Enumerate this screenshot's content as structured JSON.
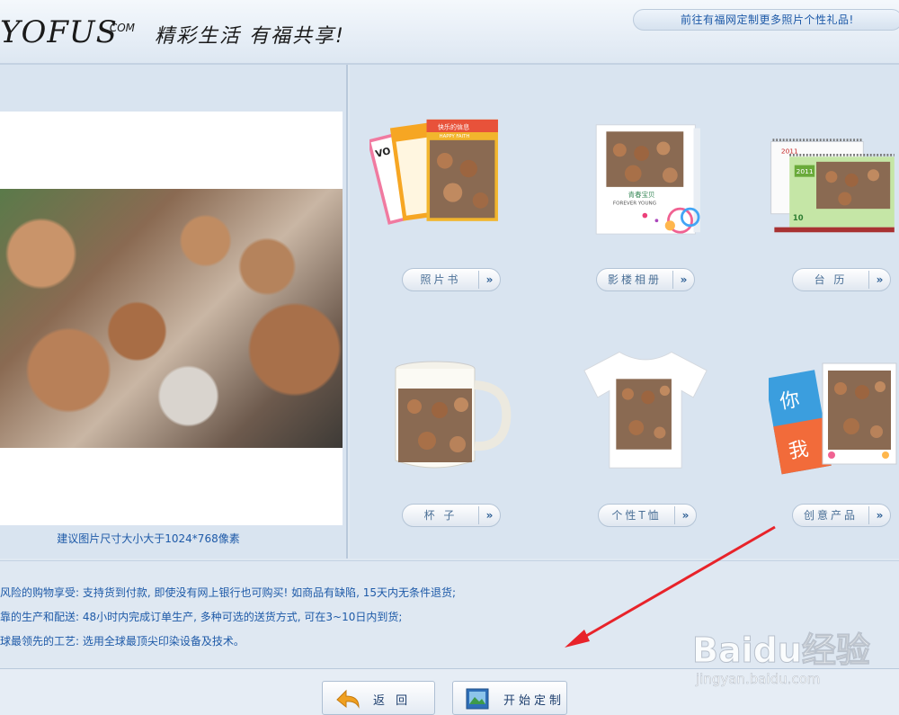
{
  "header": {
    "logo_text": "YOFUS",
    "logo_suffix": ".COM",
    "slogan": "精彩生活 有福共享!",
    "top_link": "前往有福网定制更多照片个性礼品!"
  },
  "preview": {
    "hint": "建议图片尺寸大小大于1024*768像素"
  },
  "products": [
    {
      "label": "照片书",
      "arrow": "»"
    },
    {
      "label": "影楼相册",
      "arrow": "»"
    },
    {
      "label": "台 历",
      "arrow": "»"
    },
    {
      "label": "杯 子",
      "arrow": "»"
    },
    {
      "label": "个性T恤",
      "arrow": "»"
    },
    {
      "label": "创意产品",
      "arrow": "»"
    }
  ],
  "product_art": {
    "book_cover_text": "快乐的信息",
    "book_cover_sub": "HAPPY FAITH",
    "book_side_text": "VO",
    "album_text": "FOREVER YOUNG",
    "album_title": "青春宝贝",
    "calendar_year": "2011",
    "calendar_month": "10",
    "card_char1": "你",
    "card_char2": "我"
  },
  "info": {
    "line1": "风险的购物享受: 支持货到付款, 即使没有网上银行也可购买! 如商品有缺陷, 15天内无条件退货;",
    "line2": "靠的生产和配送: 48小时内完成订单生产, 多种可选的送货方式, 可在3~10日内到货;",
    "line3": "球最领先的工艺: 选用全球最顶尖印染设备及技术。"
  },
  "footer": {
    "back_label": "返 回",
    "start_label": "开始定制"
  },
  "watermark": {
    "brand": "Baidu经验",
    "url": "jingyan.baidu.com"
  },
  "colors": {
    "accent_text": "#1e5aa8",
    "arrow_annotation": "#e8232a",
    "panel_bg": "#d9e4f0"
  }
}
